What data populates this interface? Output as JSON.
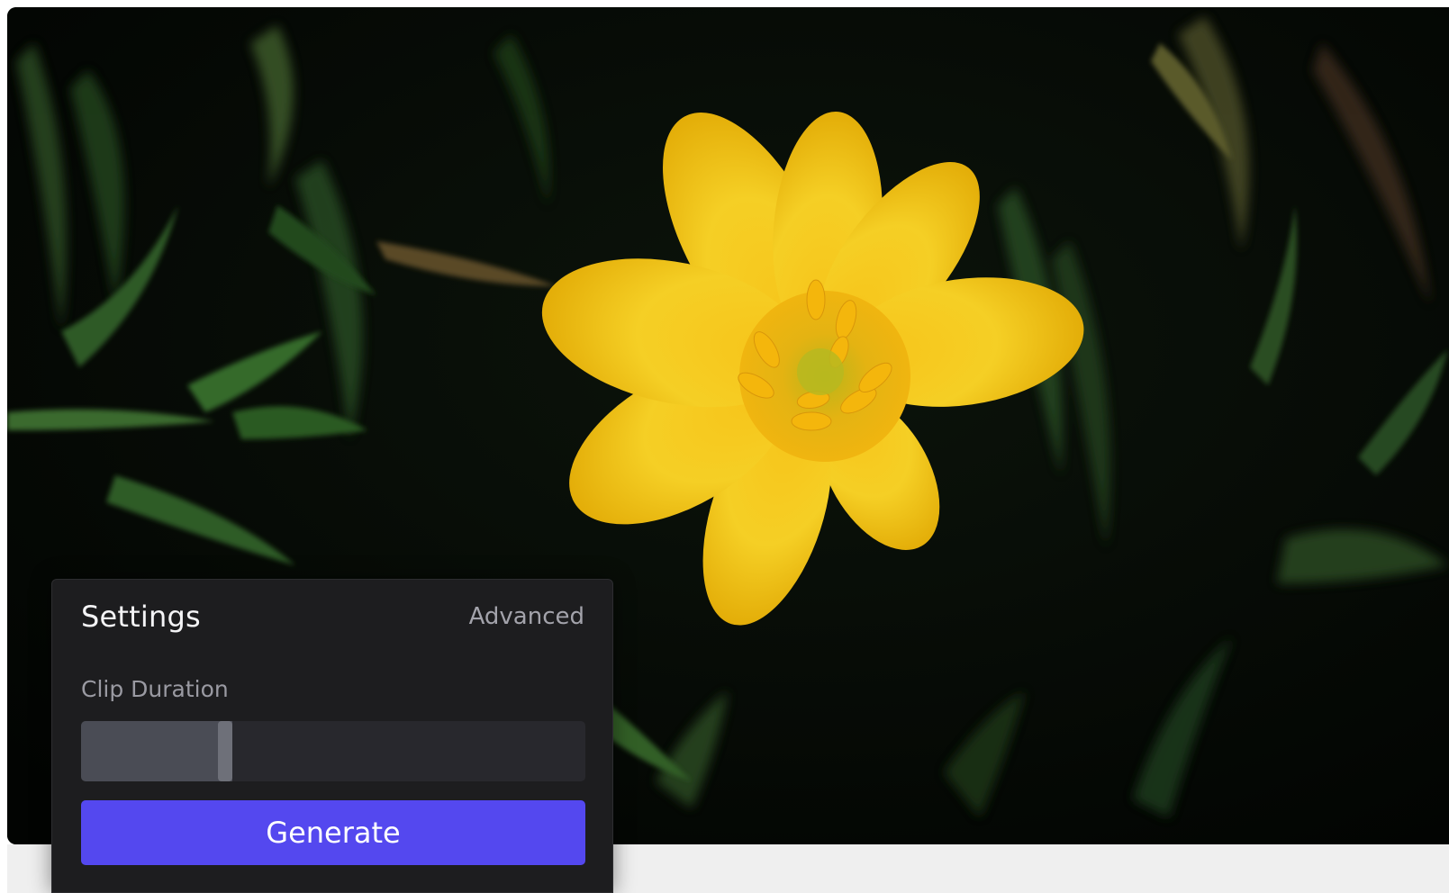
{
  "settings_panel": {
    "title": "Settings",
    "advanced_label": "Advanced",
    "clip_duration": {
      "label": "Clip Duration",
      "value_fraction": 0.3
    },
    "generate_label": "Generate"
  },
  "colors": {
    "accent": "#5448ef",
    "panel_background": "#1d1d1f",
    "slider_track": "#28282d",
    "slider_fill": "#4a4c55",
    "slider_handle": "#6e7079",
    "flower_petal": "#f2c211",
    "foliage": "#2c5a26"
  },
  "media": {
    "subject": "yellow-flower-in-grass"
  }
}
